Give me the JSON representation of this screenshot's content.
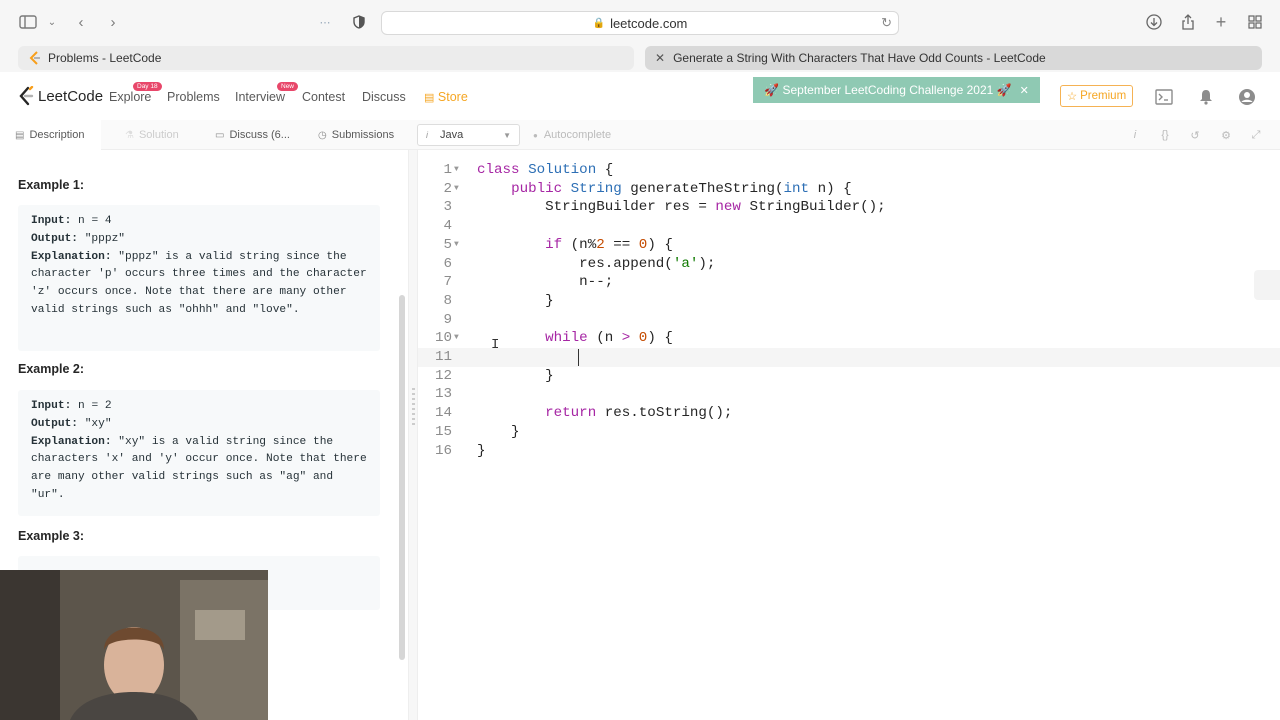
{
  "browser": {
    "url": "leetcode.com",
    "tabs": [
      {
        "title": "Problems - LeetCode",
        "active": false
      },
      {
        "title": "Generate a String With Characters That Have Odd Counts - LeetCode",
        "active": true
      }
    ]
  },
  "nav": {
    "logo": "LeetCode",
    "items": [
      {
        "label": "Explore",
        "badge": "Day 18"
      },
      {
        "label": "Problems"
      },
      {
        "label": "Interview",
        "badge": "New"
      },
      {
        "label": "Contest"
      },
      {
        "label": "Discuss"
      },
      {
        "label": "Store"
      }
    ],
    "challenge": "🚀 September LeetCoding Challenge 2021 🚀",
    "premium": "Premium",
    "colors": {
      "accent": "#f5a623",
      "challenge_bg": "#8fc9b3",
      "badge": "#e8476a"
    }
  },
  "problem_tabs": [
    {
      "label": "Description",
      "icon": "document-icon"
    },
    {
      "label": "Solution",
      "icon": "flask-icon"
    },
    {
      "label": "Discuss (6...",
      "icon": "comment-icon"
    },
    {
      "label": "Submissions",
      "icon": "clock-icon"
    }
  ],
  "editor_bar": {
    "language": "Java",
    "autocomplete": "Autocomplete"
  },
  "examples": [
    {
      "heading": "Example 1:",
      "lines": [
        {
          "label": "Input:",
          "text": " n = 4"
        },
        {
          "label": "Output:",
          "text": " \"pppz\""
        },
        {
          "label": "Explanation:",
          "text": " \"pppz\" is a valid string since the character 'p' occurs three times and the character 'z' occurs once. Note that there are many other valid strings such as \"ohhh\" and \"love\"."
        }
      ]
    },
    {
      "heading": "Example 2:",
      "lines": [
        {
          "label": "Input:",
          "text": " n = 2"
        },
        {
          "label": "Output:",
          "text": " \"xy\""
        },
        {
          "label": "Explanation:",
          "text": " \"xy\" is a valid string since the characters 'x' and 'y' occur once. Note that there are many other valid strings such as \"ag\" and \"ur\"."
        }
      ]
    },
    {
      "heading": "Example 3:",
      "lines": []
    }
  ],
  "code": [
    {
      "n": "1",
      "fold": true,
      "html": "<span class='kw'>class</span> <span class='ty'>Solution</span> {"
    },
    {
      "n": "2",
      "fold": true,
      "html": "    <span class='kw'>public</span> <span class='ty'>String</span> generateTheString(<span class='ty'>int</span> n) {"
    },
    {
      "n": "3",
      "fold": false,
      "html": "        StringBuilder res = <span class='kw'>new</span> StringBuilder();"
    },
    {
      "n": "4",
      "fold": false,
      "html": ""
    },
    {
      "n": "5",
      "fold": true,
      "html": "        <span class='kw'>if</span> (n%<span class='num'>2</span> == <span class='num'>0</span>) {"
    },
    {
      "n": "6",
      "fold": false,
      "html": "            res.append(<span class='str'>'a'</span>);"
    },
    {
      "n": "7",
      "fold": false,
      "html": "            n--;"
    },
    {
      "n": "8",
      "fold": false,
      "html": "        }"
    },
    {
      "n": "9",
      "fold": false,
      "html": ""
    },
    {
      "n": "10",
      "fold": true,
      "html": "        <span class='kw'>while</span> (n <span class='op'>&gt;</span> <span class='num'>0</span>) {"
    },
    {
      "n": "11",
      "fold": false,
      "html": ""
    },
    {
      "n": "12",
      "fold": false,
      "html": "        }"
    },
    {
      "n": "13",
      "fold": false,
      "html": ""
    },
    {
      "n": "14",
      "fold": false,
      "html": "        <span class='kw'>return</span> res.toString();"
    },
    {
      "n": "15",
      "fold": false,
      "html": "    }"
    },
    {
      "n": "16",
      "fold": false,
      "html": "}"
    }
  ],
  "current_line": "11"
}
